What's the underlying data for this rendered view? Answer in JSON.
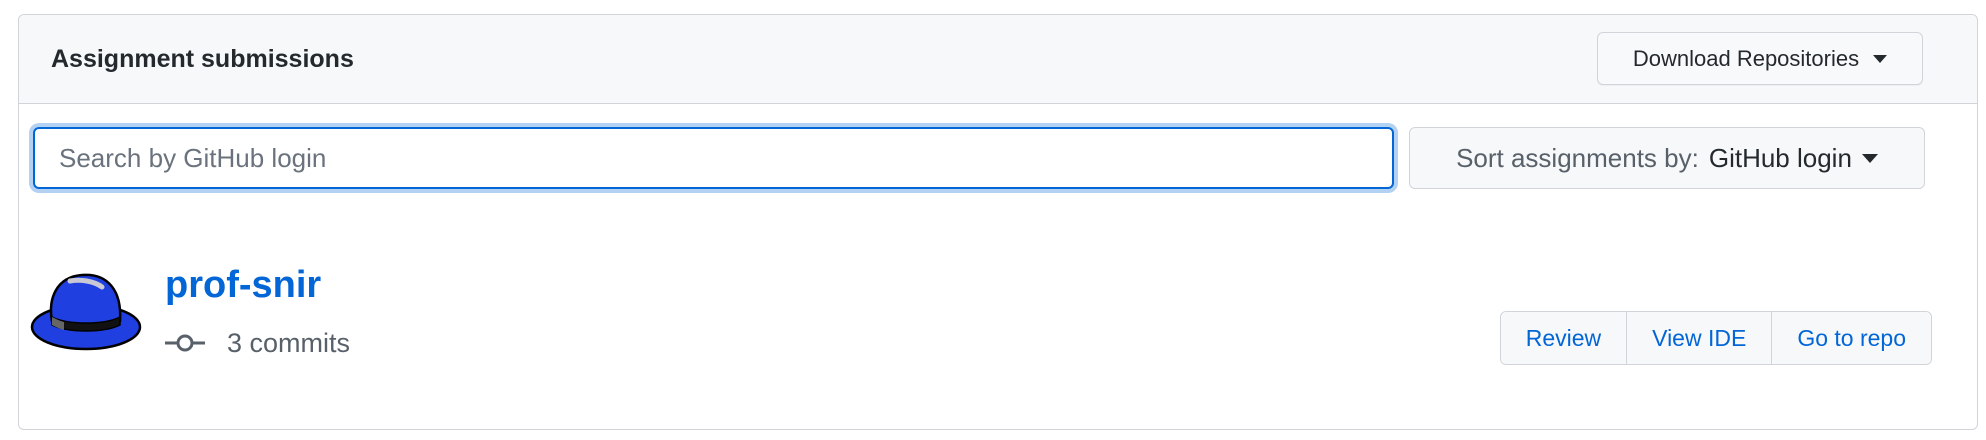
{
  "header": {
    "title": "Assignment submissions",
    "download_label": "Download Repositories"
  },
  "search": {
    "placeholder": "Search by GitHub login",
    "value": ""
  },
  "sort": {
    "prefix": "Sort assignments by:",
    "selected": "GitHub login"
  },
  "submissions": [
    {
      "login": "prof-snir",
      "commits": "3 commits",
      "avatar_icon": "blue-fedora-hat-icon",
      "actions": {
        "review": "Review",
        "view_ide": "View IDE",
        "go_to_repo": "Go to repo"
      }
    }
  ],
  "colors": {
    "link": "#0366d6",
    "focus_border": "#0366d6",
    "header_bg": "#f6f8fa",
    "border": "#d1d5da",
    "hat_blue": "#1f3fe0"
  }
}
